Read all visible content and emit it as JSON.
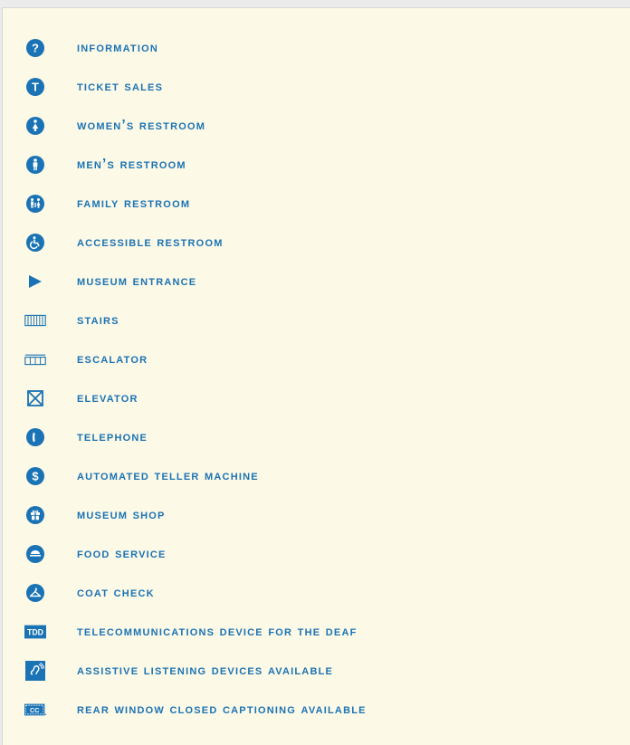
{
  "theme": {
    "accent": "#1a73b4",
    "panel_background": "#fdf9e7",
    "page_background": "#ebebeb"
  },
  "legend": {
    "items": [
      {
        "icon": "information-icon",
        "label": "INFORMATION"
      },
      {
        "icon": "ticket-sales-icon",
        "label": "TICKET SALES"
      },
      {
        "icon": "womens-restroom-icon",
        "label": "WOMEN’S RESTROOM"
      },
      {
        "icon": "mens-restroom-icon",
        "label": "MEN’S RESTROOM"
      },
      {
        "icon": "family-restroom-icon",
        "label": "FAMILY RESTROOM"
      },
      {
        "icon": "accessible-restroom-icon",
        "label": "ACCESSIBLE RESTROOM"
      },
      {
        "icon": "museum-entrance-icon",
        "label": "MUSEUM ENTRANCE"
      },
      {
        "icon": "stairs-icon",
        "label": "STAIRS"
      },
      {
        "icon": "escalator-icon",
        "label": "ESCALATOR"
      },
      {
        "icon": "elevator-icon",
        "label": "ELEVATOR"
      },
      {
        "icon": "telephone-icon",
        "label": "TELEPHONE"
      },
      {
        "icon": "atm-icon",
        "label": "AUTOMATED TELLER MACHINE"
      },
      {
        "icon": "museum-shop-icon",
        "label": "MUSEUM SHOP"
      },
      {
        "icon": "food-service-icon",
        "label": "FOOD SERVICE"
      },
      {
        "icon": "coat-check-icon",
        "label": "COAT CHECK"
      },
      {
        "icon": "tdd-icon",
        "label": "TELECOMMUNICATIONS DEVICE FOR THE DEAF",
        "icon_text": "TDD"
      },
      {
        "icon": "assistive-listening-icon",
        "label": "ASSISTIVE LISTENING DEVICES AVAILABLE"
      },
      {
        "icon": "closed-captioning-icon",
        "label": "REAR WINDOW CLOSED CAPTIONING AVAILABLE",
        "icon_text": "CC"
      }
    ]
  }
}
